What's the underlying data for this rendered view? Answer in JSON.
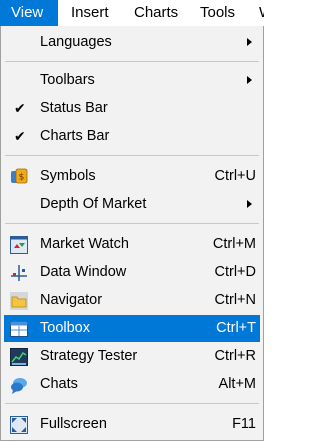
{
  "menubar": {
    "items": [
      {
        "label": "View"
      },
      {
        "label": "Insert"
      },
      {
        "label": "Charts"
      },
      {
        "label": "Tools"
      },
      {
        "label": "W"
      }
    ]
  },
  "menu": {
    "items": [
      {
        "label": "Languages",
        "submenu": true
      },
      {
        "label": "Toolbars",
        "submenu": true
      },
      {
        "label": "Status Bar",
        "checked": true
      },
      {
        "label": "Charts Bar",
        "checked": true
      },
      {
        "label": "Symbols",
        "shortcut": "Ctrl+U",
        "icon": "symbols-icon"
      },
      {
        "label": "Depth Of Market",
        "submenu": true
      },
      {
        "label": "Market Watch",
        "shortcut": "Ctrl+M",
        "icon": "market-watch-icon"
      },
      {
        "label": "Data Window",
        "shortcut": "Ctrl+D",
        "icon": "data-window-icon"
      },
      {
        "label": "Navigator",
        "shortcut": "Ctrl+N",
        "icon": "navigator-icon"
      },
      {
        "label": "Toolbox",
        "shortcut": "Ctrl+T",
        "icon": "toolbox-icon",
        "highlighted": true
      },
      {
        "label": "Strategy Tester",
        "shortcut": "Ctrl+R",
        "icon": "strategy-tester-icon"
      },
      {
        "label": "Chats",
        "shortcut": "Alt+M",
        "icon": "chats-icon"
      },
      {
        "label": "Fullscreen",
        "shortcut": "F11",
        "icon": "fullscreen-icon"
      }
    ]
  },
  "colors": {
    "highlight": "#0078d7",
    "menu_background": "#f2f2f2",
    "separator": "#c8c8c8"
  }
}
